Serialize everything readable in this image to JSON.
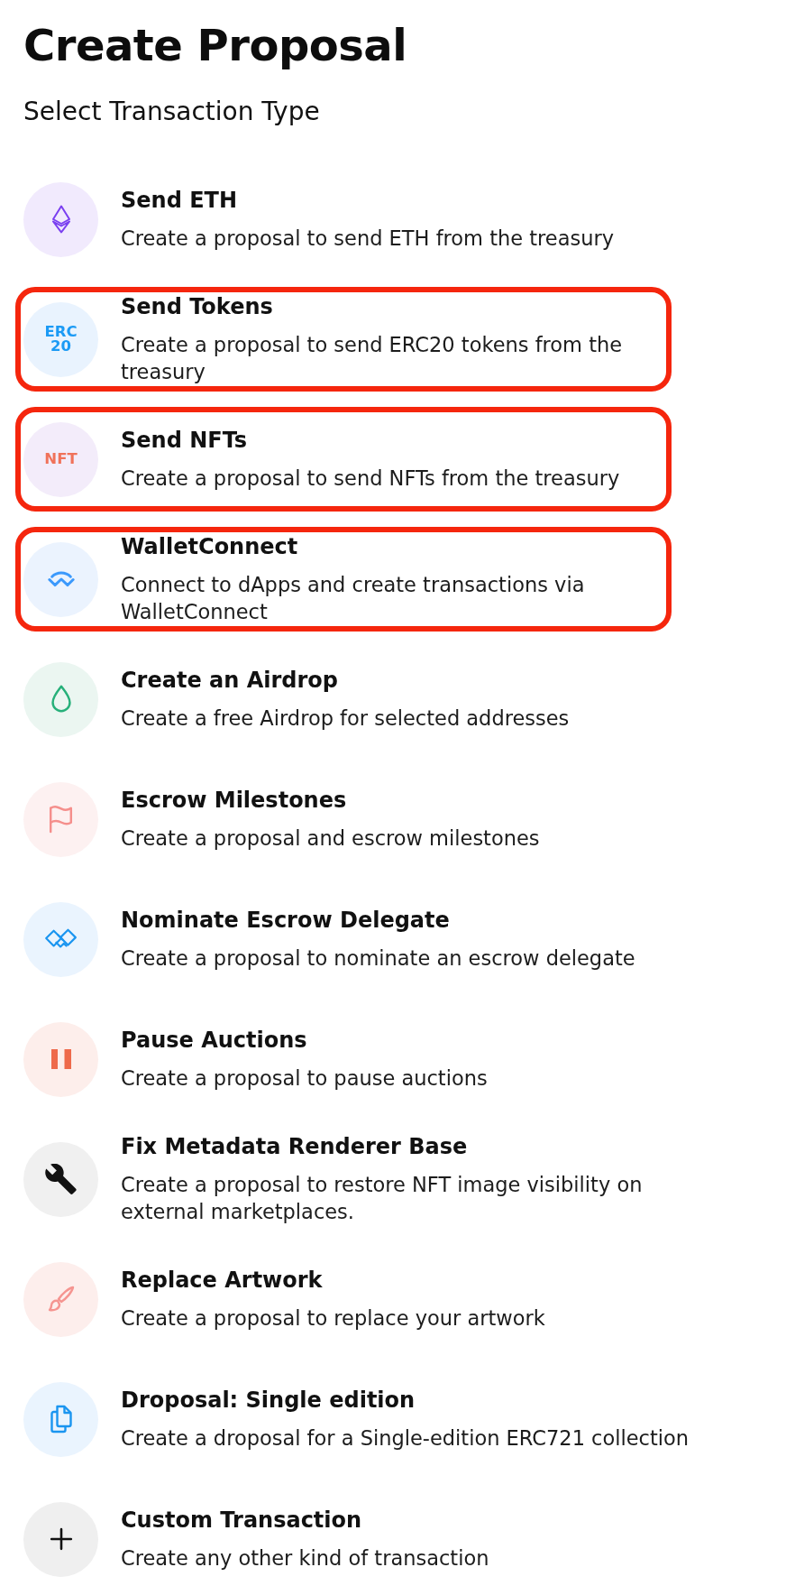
{
  "page": {
    "title": "Create Proposal",
    "subtitle": "Select Transaction Type"
  },
  "items": [
    {
      "kind": "ether",
      "title": "Send ETH",
      "description": "Create a proposal to send ETH from the treasury",
      "highlighted": false
    },
    {
      "kind": "tokens",
      "icon_text": [
        "ERC",
        "20"
      ],
      "title": "Send Tokens",
      "description": "Create a proposal to send ERC20 tokens from the treasury",
      "highlighted": true
    },
    {
      "kind": "nft",
      "icon_text": [
        "NFT"
      ],
      "title": "Send NFTs",
      "description": "Create a proposal to send NFTs from the treasury",
      "highlighted": true
    },
    {
      "kind": "walletconnect",
      "title": "WalletConnect",
      "description": "Connect to dApps and create transactions via WalletConnect",
      "highlighted": true
    },
    {
      "kind": "airdrop",
      "title": "Create an Airdrop",
      "description": "Create a free Airdrop for selected addresses",
      "highlighted": false
    },
    {
      "kind": "escrow",
      "title": "Escrow Milestones",
      "description": "Create a proposal and escrow milestones",
      "highlighted": false
    },
    {
      "kind": "delegate",
      "title": "Nominate Escrow Delegate",
      "description": "Create a proposal to nominate an escrow delegate",
      "highlighted": false
    },
    {
      "kind": "pause",
      "title": "Pause Auctions",
      "description": "Create a proposal to pause auctions",
      "highlighted": false
    },
    {
      "kind": "metadata",
      "title": "Fix Metadata Renderer Base",
      "description": "Create a proposal to restore NFT image visibility on external marketplaces.",
      "highlighted": false
    },
    {
      "kind": "artwork",
      "title": "Replace Artwork",
      "description": "Create a proposal to replace your artwork",
      "highlighted": false
    },
    {
      "kind": "droposal",
      "title": "Droposal: Single edition",
      "description": "Create a droposal for a Single-edition ERC721 collection",
      "highlighted": false
    },
    {
      "kind": "custom",
      "title": "Custom Transaction",
      "description": "Create any other kind of transaction",
      "highlighted": false
    }
  ]
}
